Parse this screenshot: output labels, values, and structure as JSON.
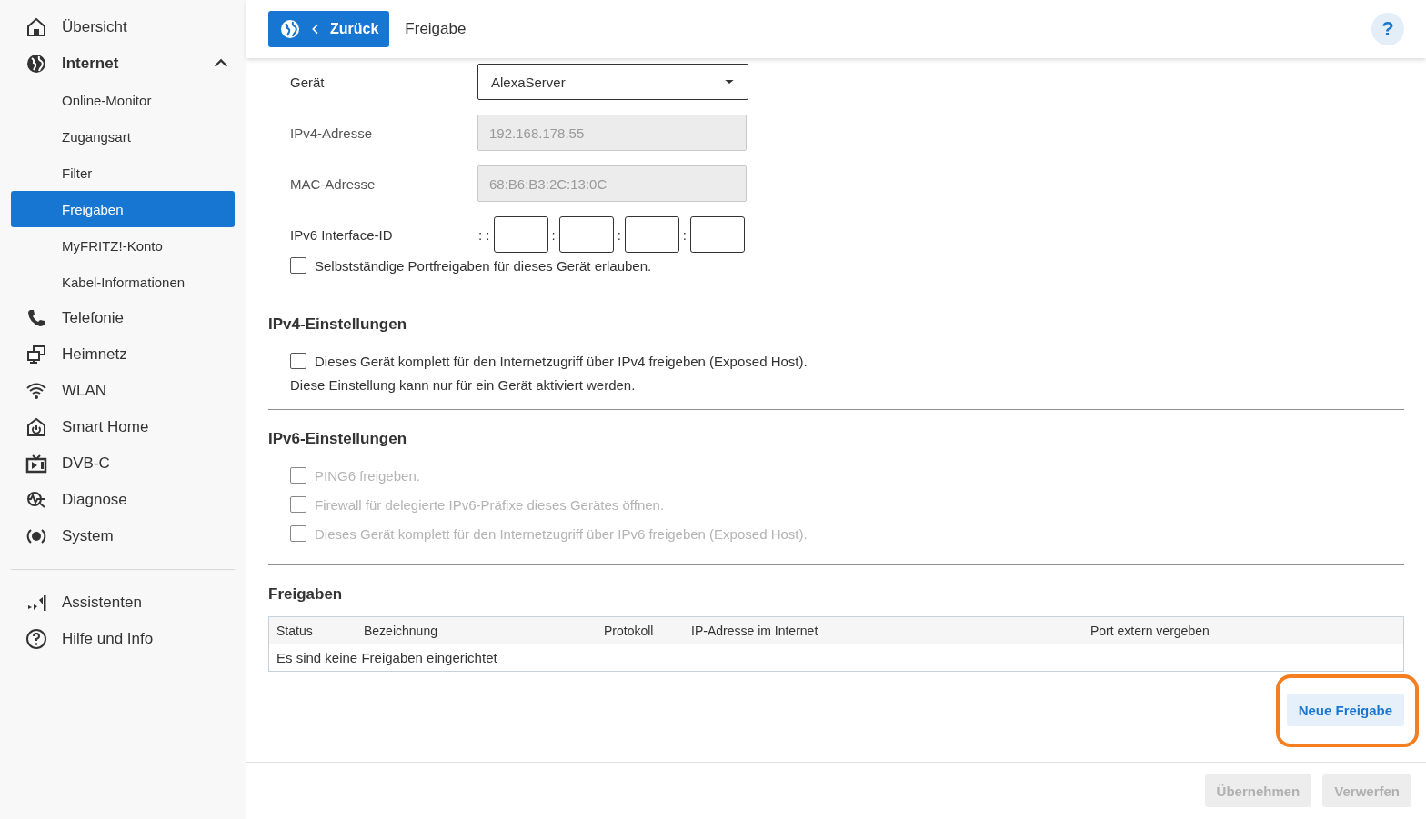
{
  "sidebar": {
    "items": [
      {
        "label": "Übersicht",
        "selected": false
      },
      {
        "label": "Internet",
        "selected": false,
        "expanded": true,
        "children": [
          {
            "label": "Online-Monitor",
            "selected": false
          },
          {
            "label": "Zugangsart",
            "selected": false
          },
          {
            "label": "Filter",
            "selected": false
          },
          {
            "label": "Freigaben",
            "selected": true
          },
          {
            "label": "MyFRITZ!-Konto",
            "selected": false
          },
          {
            "label": "Kabel-Informationen",
            "selected": false
          }
        ]
      },
      {
        "label": "Telefonie",
        "selected": false
      },
      {
        "label": "Heimnetz",
        "selected": false
      },
      {
        "label": "WLAN",
        "selected": false
      },
      {
        "label": "Smart Home",
        "selected": false
      },
      {
        "label": "DVB-C",
        "selected": false
      },
      {
        "label": "Diagnose",
        "selected": false
      },
      {
        "label": "System",
        "selected": false
      }
    ],
    "bottom_items": [
      {
        "label": "Assistenten",
        "selected": false
      },
      {
        "label": "Hilfe und Info",
        "selected": false
      }
    ]
  },
  "header": {
    "back_button": {
      "label": "Zurück"
    },
    "title": "Freigabe",
    "help_button": {
      "label": "?"
    }
  },
  "device_form": {
    "device": {
      "label": "Gerät",
      "value": "AlexaServer"
    },
    "ipv4_address": {
      "label": "IPv4-Adresse",
      "value": "192.168.178.55",
      "disabled": true
    },
    "mac_address": {
      "label": "MAC-Adresse",
      "value": "68:B6:B3:2C:13:0C",
      "disabled": true
    },
    "ipv6_interface_id": {
      "label": "IPv6 Interface-ID",
      "fields": [
        {
          "prefix": ": :"
        },
        {
          "prefix": ":"
        },
        {
          "prefix": ":"
        },
        {
          "prefix": ":"
        }
      ]
    },
    "auto_port_sharing": {
      "label": "Selbstständige Portfreigaben für dieses Gerät erlauben.",
      "checked": false,
      "disabled": false
    }
  },
  "sections": [
    {
      "title": "IPv4-Einstellungen",
      "checkboxes": [
        {
          "label": "Dieses Gerät komplett für den Internetzugriff über IPv4 freigeben (Exposed Host).",
          "checked": false,
          "disabled": false
        }
      ],
      "note": "Diese Einstellung kann nur für ein Gerät aktiviert werden."
    },
    {
      "title": "IPv6-Einstellungen",
      "checkboxes": [
        {
          "label": "PING6 freigeben.",
          "checked": false,
          "disabled": true
        },
        {
          "label": "Firewall für delegierte IPv6-Präfixe dieses Gerätes öffnen.",
          "checked": false,
          "disabled": true
        },
        {
          "label": "Dieses Gerät komplett für den Internetzugriff über IPv6 freigeben (Exposed Host).",
          "checked": false,
          "disabled": true
        }
      ]
    }
  ],
  "shares": {
    "title": "Freigaben",
    "table": {
      "columns": [
        "Status",
        "Bezeichnung",
        "Protokoll",
        "IP-Adresse im Internet",
        "Port extern vergeben"
      ],
      "empty_message": "Es sind keine Freigaben eingerichtet"
    },
    "new_button": {
      "label": "Neue Freigabe",
      "highlighted": true
    }
  },
  "footer": {
    "buttons": [
      {
        "label": "Übernehmen",
        "disabled": true
      },
      {
        "label": "Verwerfen",
        "disabled": true
      }
    ]
  }
}
